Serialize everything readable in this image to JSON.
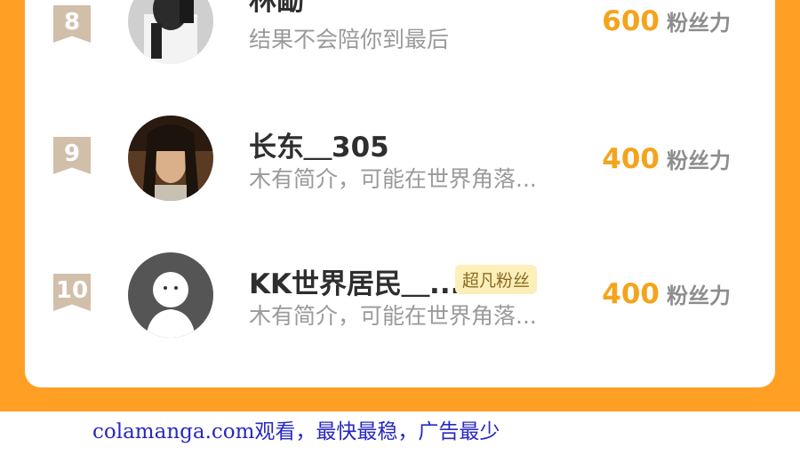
{
  "rows": [
    {
      "rank": "8",
      "name": "林勔",
      "bio": "结果不会陪你到最后",
      "score": "600",
      "unit": "粉丝力",
      "badge": ""
    },
    {
      "rank": "9",
      "name": "长东＿305",
      "bio": "木有简介，可能在世界角落...",
      "score": "400",
      "unit": "粉丝力",
      "badge": ""
    },
    {
      "rank": "10",
      "name": "KK世界居民＿...",
      "bio": "木有简介，可能在世界角落...",
      "score": "400",
      "unit": "粉丝力",
      "badge": "超凡粉丝"
    }
  ],
  "footer": {
    "text": "colamanga.com观看，最快最稳，广告最少"
  },
  "colors": {
    "accent": "#ff9f24",
    "score": "#f4a41c",
    "badge_bg": "#fcefb9",
    "rank_bg": "#d1bfaa",
    "footer": "#2828c0"
  }
}
